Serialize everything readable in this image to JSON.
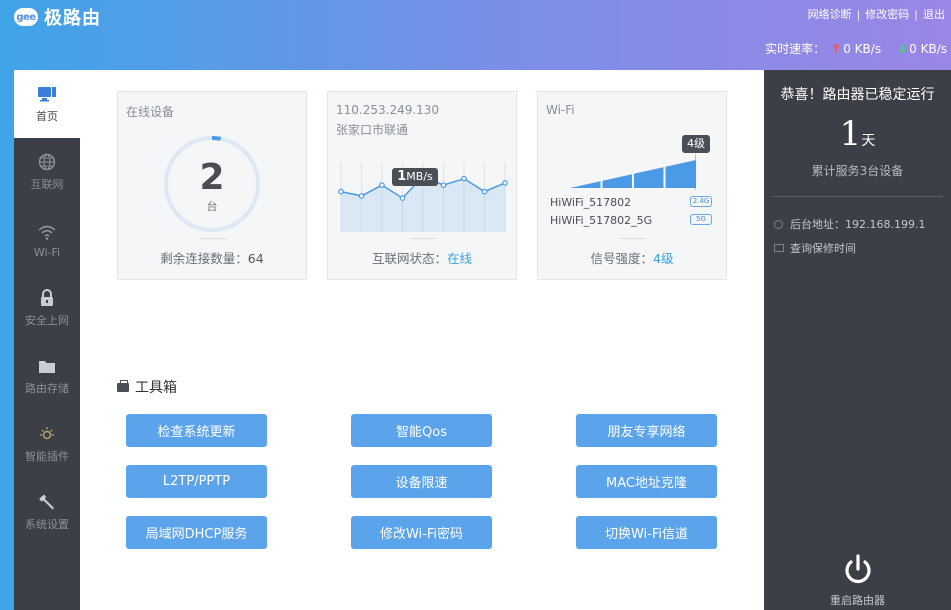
{
  "header": {
    "logo_badge": "gee",
    "logo_text": "极路由",
    "links": [
      "网络诊断",
      "修改密码",
      "退出"
    ],
    "speed_label": "实时速率：",
    "upload_speed": "0 KB/s",
    "download_speed": "0 KB/s",
    "up_arrow": "↑",
    "down_arrow": "↓"
  },
  "nav": {
    "items": [
      {
        "label": "首页",
        "icon": "monitor-icon",
        "active": true
      },
      {
        "label": "互联网",
        "icon": "globe-icon",
        "active": false
      },
      {
        "label": "Wi-Fi",
        "icon": "wifi-icon",
        "active": false
      },
      {
        "label": "安全上网",
        "icon": "lock-icon",
        "active": false
      },
      {
        "label": "路由存储",
        "icon": "folder-icon",
        "active": false
      },
      {
        "label": "智能插件",
        "icon": "sun-icon",
        "active": false
      },
      {
        "label": "系统设置",
        "icon": "wrench-icon",
        "active": false
      }
    ]
  },
  "devices_card": {
    "title": "在线设备",
    "count": "2",
    "unit": "台",
    "footer_label": "剩余连接数量：",
    "footer_value": "64",
    "used_fraction": 0.03
  },
  "internet_card": {
    "ip": "110.253.249.130",
    "isp": "张家口市联通",
    "speed_value": "1",
    "speed_unit": "MB/s",
    "footer_label": "互联网状态：",
    "footer_value": "在线",
    "spark_values": [
      3,
      2.6,
      3.6,
      2.4,
      4.4,
      3.6,
      4.2,
      3.0,
      3.8
    ]
  },
  "wifi_card": {
    "title": "Wi-Fi",
    "level_badge": "4级",
    "level": 4,
    "level_max": 4,
    "ssids": [
      {
        "name": "HiWiFi_517802",
        "band": "2.4G"
      },
      {
        "name": "HiWiFi_517802_5G",
        "band": "5G"
      }
    ],
    "footer_label": "信号强度：",
    "footer_value": "4级"
  },
  "toolbox": {
    "title": "工具箱",
    "buttons": [
      "检查系统更新",
      "智能Qos",
      "朋友专享网络",
      "L2TP/PPTP",
      "设备限速",
      "MAC地址克隆",
      "局域网DHCP服务",
      "修改Wi-Fi密码",
      "切换Wi-Fi信道"
    ]
  },
  "right_panel": {
    "title": "恭喜！路由器已稳定运行",
    "days": "1",
    "days_unit": "天",
    "served": "累计服务3台设备",
    "admin_address": "后台地址：192.168.199.1",
    "warranty": "查询保修时间",
    "reboot": "重启路由器"
  },
  "colors": {
    "accent": "#5ba4ec",
    "dark_panel": "#3c3f45",
    "card_bg": "#f4f6f8",
    "link_blue": "#3aa0e6"
  }
}
